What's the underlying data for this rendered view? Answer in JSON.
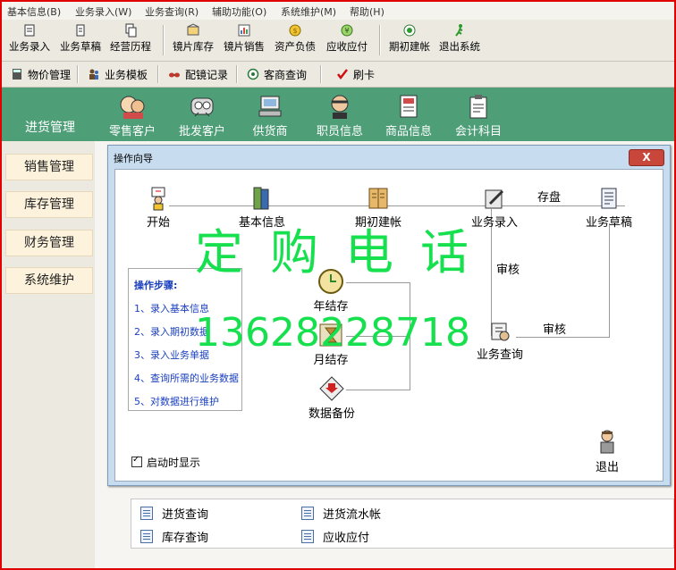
{
  "menubar": [
    "基本信息(B)",
    "业务录入(W)",
    "业务查询(R)",
    "辅助功能(O)",
    "系统维护(M)",
    "帮助(H)"
  ],
  "toolbar": [
    "业务录入",
    "业务草稿",
    "经营历程",
    "镜片库存",
    "镜片销售",
    "资产负债",
    "应收应付",
    "期初建帐",
    "退出系统"
  ],
  "toolbar2": [
    "物价管理",
    "业务模板",
    "配镜记录",
    "客商查询",
    "刷卡"
  ],
  "nav": [
    "零售客户",
    "批发客户",
    "供货商",
    "职员信息",
    "商品信息",
    "会计科目"
  ],
  "sidebar": {
    "active": "进货管理",
    "items": [
      "销售管理",
      "库存管理",
      "财务管理",
      "系统维护"
    ]
  },
  "dialog": {
    "title": "操作向导",
    "close": "X",
    "flow": {
      "start": "开始",
      "basic_info": "基本信息",
      "opening": "期初建帐",
      "entry": "业务录入",
      "save": "存盘",
      "draft": "业务草稿",
      "audit1": "审核",
      "audit2": "审核",
      "year_end": "年结存",
      "month_end": "月结存",
      "query": "业务查询",
      "backup": "数据备份",
      "exit": "退出"
    },
    "steps_title": "操作步骤:",
    "steps": [
      "1、录入基本信息",
      "2、录入期初数据",
      "3、录入业务单据",
      "4、查询所需的业务数据",
      "5、对数据进行维护"
    ],
    "startup_checkbox": "启动时显示"
  },
  "watermark": {
    "line1": "定购电话",
    "line2": "13628228718"
  },
  "bottom_links": [
    "进货查询",
    "进货流水帐",
    "库存查询",
    "应收应付"
  ],
  "colors": {
    "frame": "#e00000",
    "nav_green": "#4e9e78",
    "dialog_bg": "#c7ddef",
    "watermark": "#17e04f",
    "steps_text": "#1a3fbf"
  }
}
